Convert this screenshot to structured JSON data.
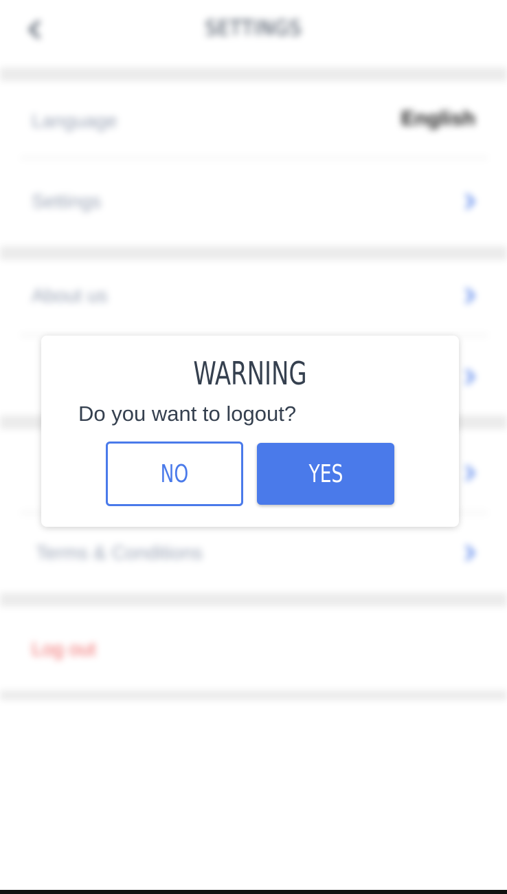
{
  "header": {
    "title": "SETTINGS",
    "back_icon": "chevron-left-icon"
  },
  "settings": {
    "language_label": "Language",
    "language_value": "English",
    "rows_group1": [
      {
        "label": "Settings"
      }
    ],
    "rows_group2": [
      {
        "label": "About us"
      },
      {
        "label": ""
      },
      {
        "label": ""
      },
      {
        "label": "Terms & Conditions"
      }
    ],
    "logout_label": "Log out"
  },
  "dialog": {
    "title": "WARNING",
    "message": "Do you want to logout?",
    "no_label": "NO",
    "yes_label": "YES"
  },
  "colors": {
    "accent": "#4a7aea",
    "title_text": "#35404f",
    "logout": "#f06a6a",
    "divider": "#ebebeb"
  }
}
